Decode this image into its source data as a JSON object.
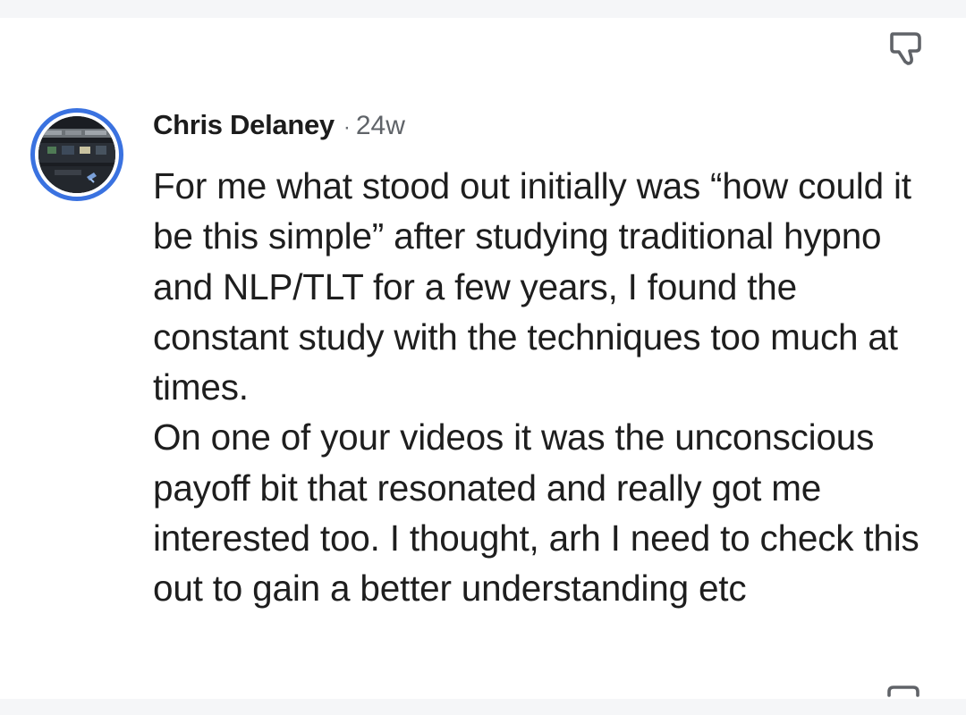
{
  "comment": {
    "author": "Chris Delaney",
    "separator": "·",
    "timestamp": "24w",
    "text": "For me what stood out initially was “how could it be this simple” after studying traditional hypno and NLP/TLT for a few years, I found the constant study with the techniques too much at times.\nOn one of your videos it was the unconscious payoff bit that resonated and really got me interested too. I thought, arh I need to check this out to gain a better understanding etc"
  },
  "icons": {
    "dislike": "thumbs-down-icon",
    "reply": "speech-bubble-icon"
  },
  "colors": {
    "avatar_ring": "#3a72e0",
    "background": "#ffffff",
    "strip": "#f5f6f8",
    "text": "#1e1e1e",
    "muted": "#5f6368"
  }
}
